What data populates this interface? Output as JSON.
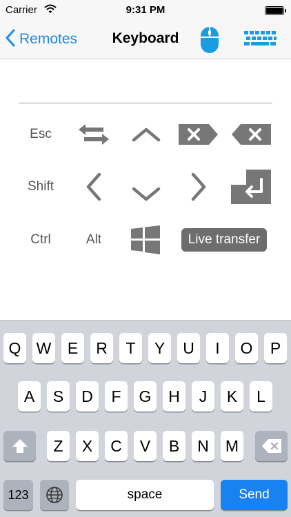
{
  "status_bar": {
    "carrier": "Carrier",
    "time": "9:31 PM"
  },
  "nav": {
    "back_label": "Remotes",
    "title": "Keyboard"
  },
  "controls": {
    "esc": "Esc",
    "shift": "Shift",
    "ctrl": "Ctrl",
    "alt": "Alt",
    "live_transfer": "Live transfer"
  },
  "keyboard": {
    "row1": [
      "Q",
      "W",
      "E",
      "R",
      "T",
      "Y",
      "U",
      "I",
      "O",
      "P"
    ],
    "row2": [
      "A",
      "S",
      "D",
      "F",
      "G",
      "H",
      "J",
      "K",
      "L"
    ],
    "row3": [
      "Z",
      "X",
      "C",
      "V",
      "B",
      "N",
      "M"
    ],
    "numbers_label": "123",
    "space_label": "space",
    "send_label": "Send"
  },
  "colors": {
    "accent": "#1a8ce0",
    "control_gray": "#777777",
    "send_blue": "#1a82f0"
  }
}
